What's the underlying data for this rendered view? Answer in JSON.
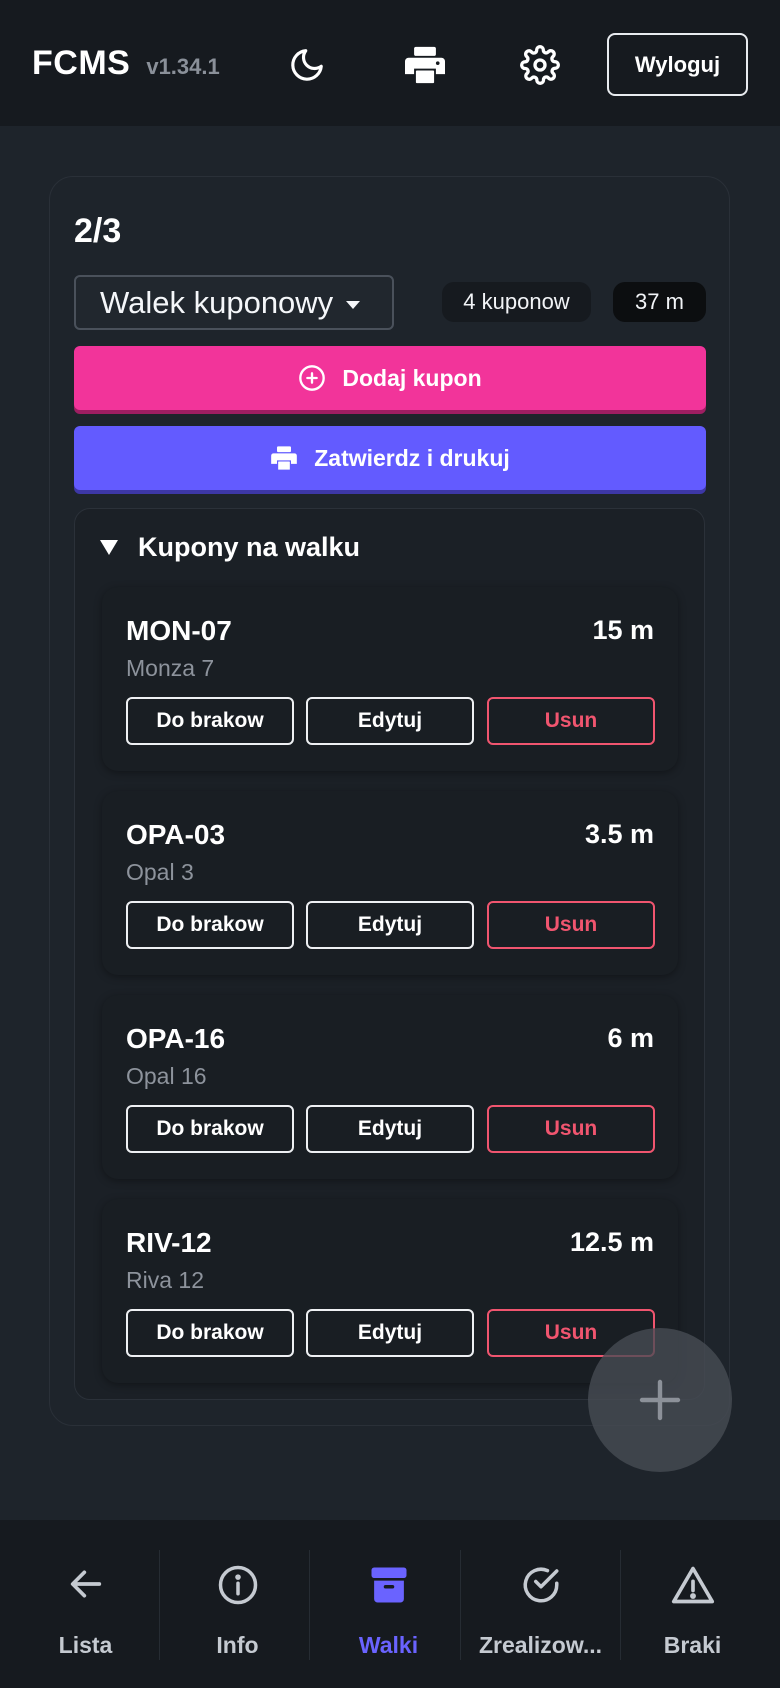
{
  "header": {
    "brand": "FCMS",
    "version": "v1.34.1",
    "icons": [
      "moon-icon",
      "printer-icon",
      "gear-icon"
    ],
    "logout_label": "Wyloguj"
  },
  "main": {
    "counter": "2/3",
    "select_value": "Walek kuponowy",
    "coupon_count": "4 kuponow",
    "total_length": "37 m",
    "add_button": "Dodaj kupon",
    "print_button": "Zatwierdz i drukuj",
    "section_title": "Kupony na walku",
    "coupons": [
      {
        "code": "MON-07",
        "name": "Monza 7",
        "length": "15 m"
      },
      {
        "code": "OPA-03",
        "name": "Opal 3",
        "length": "3.5 m"
      },
      {
        "code": "OPA-16",
        "name": "Opal 16",
        "length": "6 m"
      },
      {
        "code": "RIV-12",
        "name": "Riva 12",
        "length": "12.5 m"
      }
    ],
    "coupon_actions": {
      "defect": "Do brakow",
      "edit": "Edytuj",
      "delete": "Usun"
    }
  },
  "bottom_nav": {
    "items": [
      {
        "label": "Lista",
        "icon": "arrow-left-icon"
      },
      {
        "label": "Info",
        "icon": "info-icon"
      },
      {
        "label": "Walki",
        "icon": "archive-box-icon",
        "active": true
      },
      {
        "label": "Zrealizow...",
        "icon": "check-circle-icon"
      },
      {
        "label": "Braki",
        "icon": "warning-icon"
      }
    ]
  },
  "colors": {
    "accent_pink": "#f2349a",
    "accent_purple": "#635bff",
    "danger": "#f0556f",
    "active_nav": "#6a63ff"
  }
}
